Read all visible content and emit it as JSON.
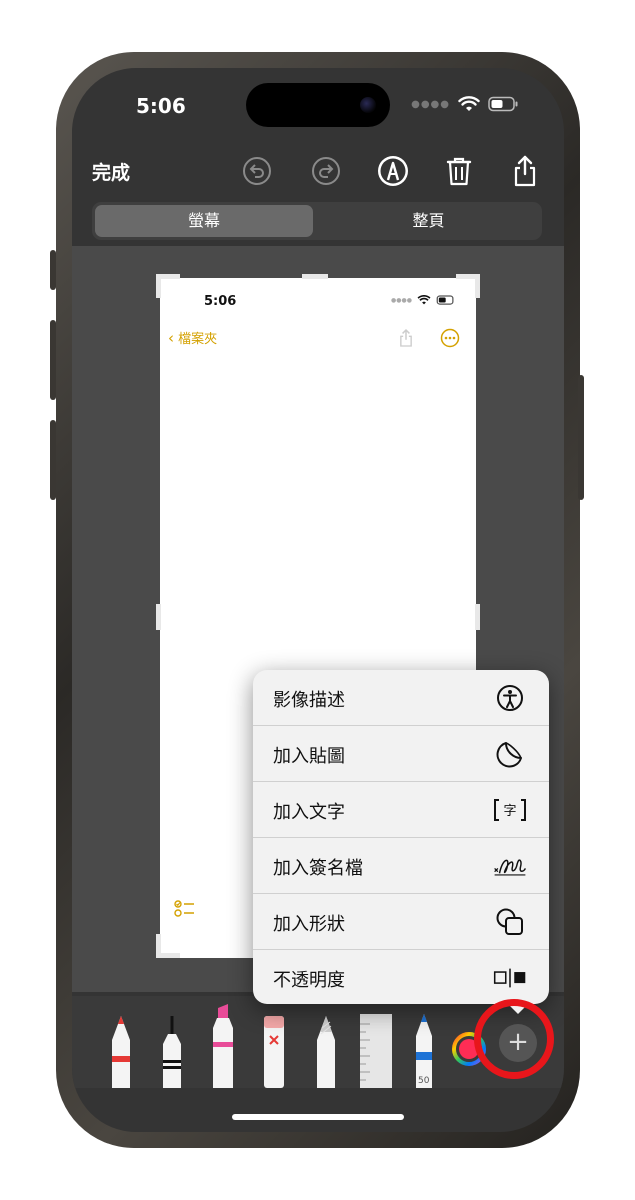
{
  "status_bar": {
    "time": "5:06"
  },
  "toolbar": {
    "done_label": "完成"
  },
  "segment": {
    "screen_label": "螢幕",
    "full_page_label": "整頁",
    "selected": "螢幕"
  },
  "document": {
    "status_time": "5:06",
    "back_label": "檔案夾"
  },
  "menu": {
    "items": [
      {
        "label": "影像描述",
        "icon": "accessibility-icon"
      },
      {
        "label": "加入貼圖",
        "icon": "sticker-icon"
      },
      {
        "label": "加入文字",
        "icon": "text-box-icon"
      },
      {
        "label": "加入簽名檔",
        "icon": "signature-icon"
      },
      {
        "label": "加入形狀",
        "icon": "shapes-icon"
      },
      {
        "label": "不透明度",
        "icon": "opacity-icon"
      }
    ]
  },
  "tools": {
    "items": [
      "pen-tool",
      "fineliner-tool",
      "marker-tool",
      "eraser-tool",
      "pencil-tool",
      "ruler-tool",
      "crayon-tool",
      "color-picker",
      "add-button"
    ],
    "crayon_number": "50",
    "add_label": "+"
  },
  "colors": {
    "accent_yellow": "#d4a100",
    "highlight_ring": "#e8161b",
    "screen_bg": "#343434"
  }
}
